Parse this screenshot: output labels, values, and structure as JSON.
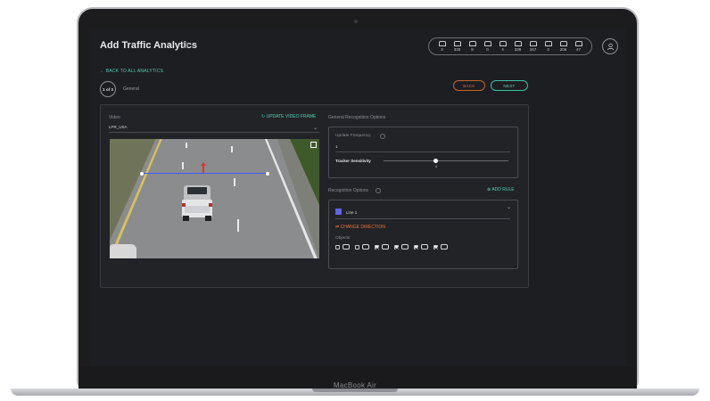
{
  "window": {
    "title": "Add Traffic Analytics"
  },
  "device": {
    "label": "MacBook Air"
  },
  "stats": [
    {
      "icon": "car-icon",
      "value": "3"
    },
    {
      "icon": "bus-icon",
      "value": "330"
    },
    {
      "icon": "taxi-icon",
      "value": "8"
    },
    {
      "icon": "sign-icon",
      "value": "0"
    },
    {
      "icon": "hand-icon",
      "value": "4"
    },
    {
      "icon": "pedestrian-icon",
      "value": "338"
    },
    {
      "icon": "scooter-icon",
      "value": "167"
    },
    {
      "icon": "warning-icon",
      "value": "3"
    },
    {
      "icon": "truck-icon",
      "value": "206"
    },
    {
      "icon": "bike-icon",
      "value": "47"
    }
  ],
  "nav": {
    "back_link": "← BACK TO ALL ANALYTICS",
    "step_badge": "1 of 3",
    "step_label": "General",
    "back_button": "BACK",
    "next_button": "NEXT"
  },
  "video": {
    "label": "Video",
    "update_frame": "UPDATE VIDEO FRAME",
    "selected": "LPR_USA"
  },
  "general_options": {
    "title": "General Recognition Options",
    "update_frequency_label": "Update Frequency",
    "update_frequency_value": "1",
    "tracker_sensitivity_label": "Tracker Sensitivity",
    "tracker_sensitivity_value": "4",
    "tracker_sensitivity_fraction": 0.42
  },
  "recognition_options": {
    "title": "Recognition Options",
    "add_rule": "ADD RULE",
    "line_name": "Line 1",
    "line_color": "#5b67e6",
    "change_direction": "CHANGE DIRECTION",
    "objects_label": "Objects",
    "objects": [
      {
        "icon": "pedestrian-icon",
        "checked": false
      },
      {
        "icon": "bicycle-icon",
        "checked": false
      },
      {
        "icon": "car-icon",
        "checked": true
      },
      {
        "icon": "car-crossed-icon",
        "checked": true
      },
      {
        "icon": "bus-icon",
        "checked": true
      },
      {
        "icon": "truck-icon",
        "checked": true
      }
    ]
  },
  "colors": {
    "accent": "#4fd1b5",
    "back_button": "#d3743e",
    "change_direction": "#e8743a",
    "detection_line": "#3b5bff",
    "direction_arrow": "#e5322d"
  }
}
